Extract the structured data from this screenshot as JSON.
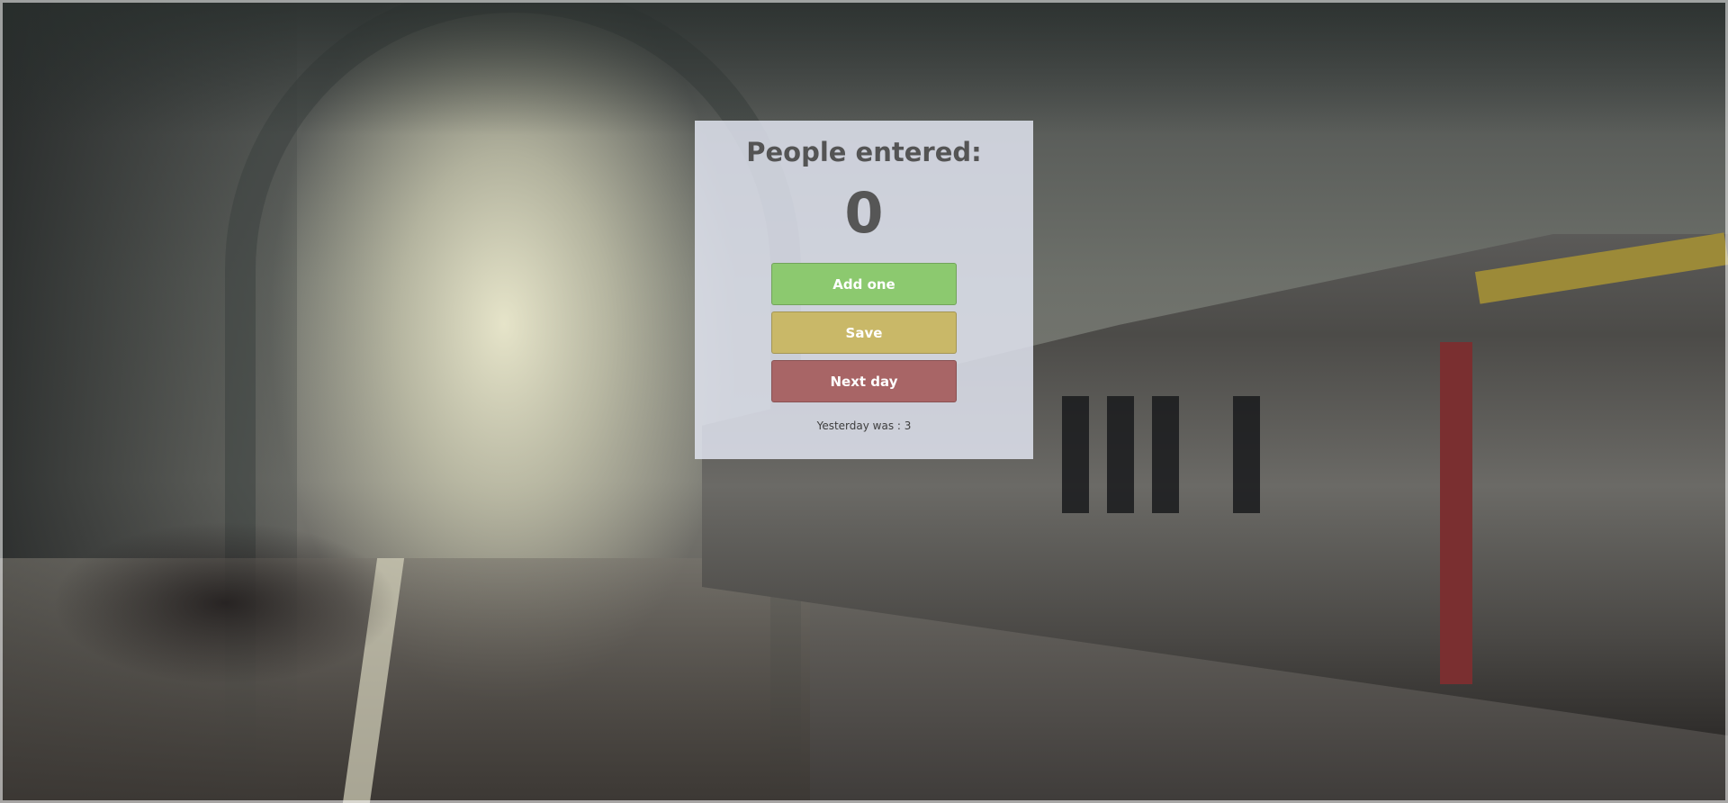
{
  "counter": {
    "title": "People entered:",
    "count": "0",
    "buttons": {
      "add_label": "Add one",
      "save_label": "Save",
      "next_label": "Next day"
    },
    "yesterday_text": "Yesterday was : 3"
  },
  "colors": {
    "add": "#8cc96f",
    "save": "#c9b868",
    "next": "#a86566",
    "panel": "#e0e4f0"
  },
  "background": {
    "image": "train-station-photo"
  }
}
